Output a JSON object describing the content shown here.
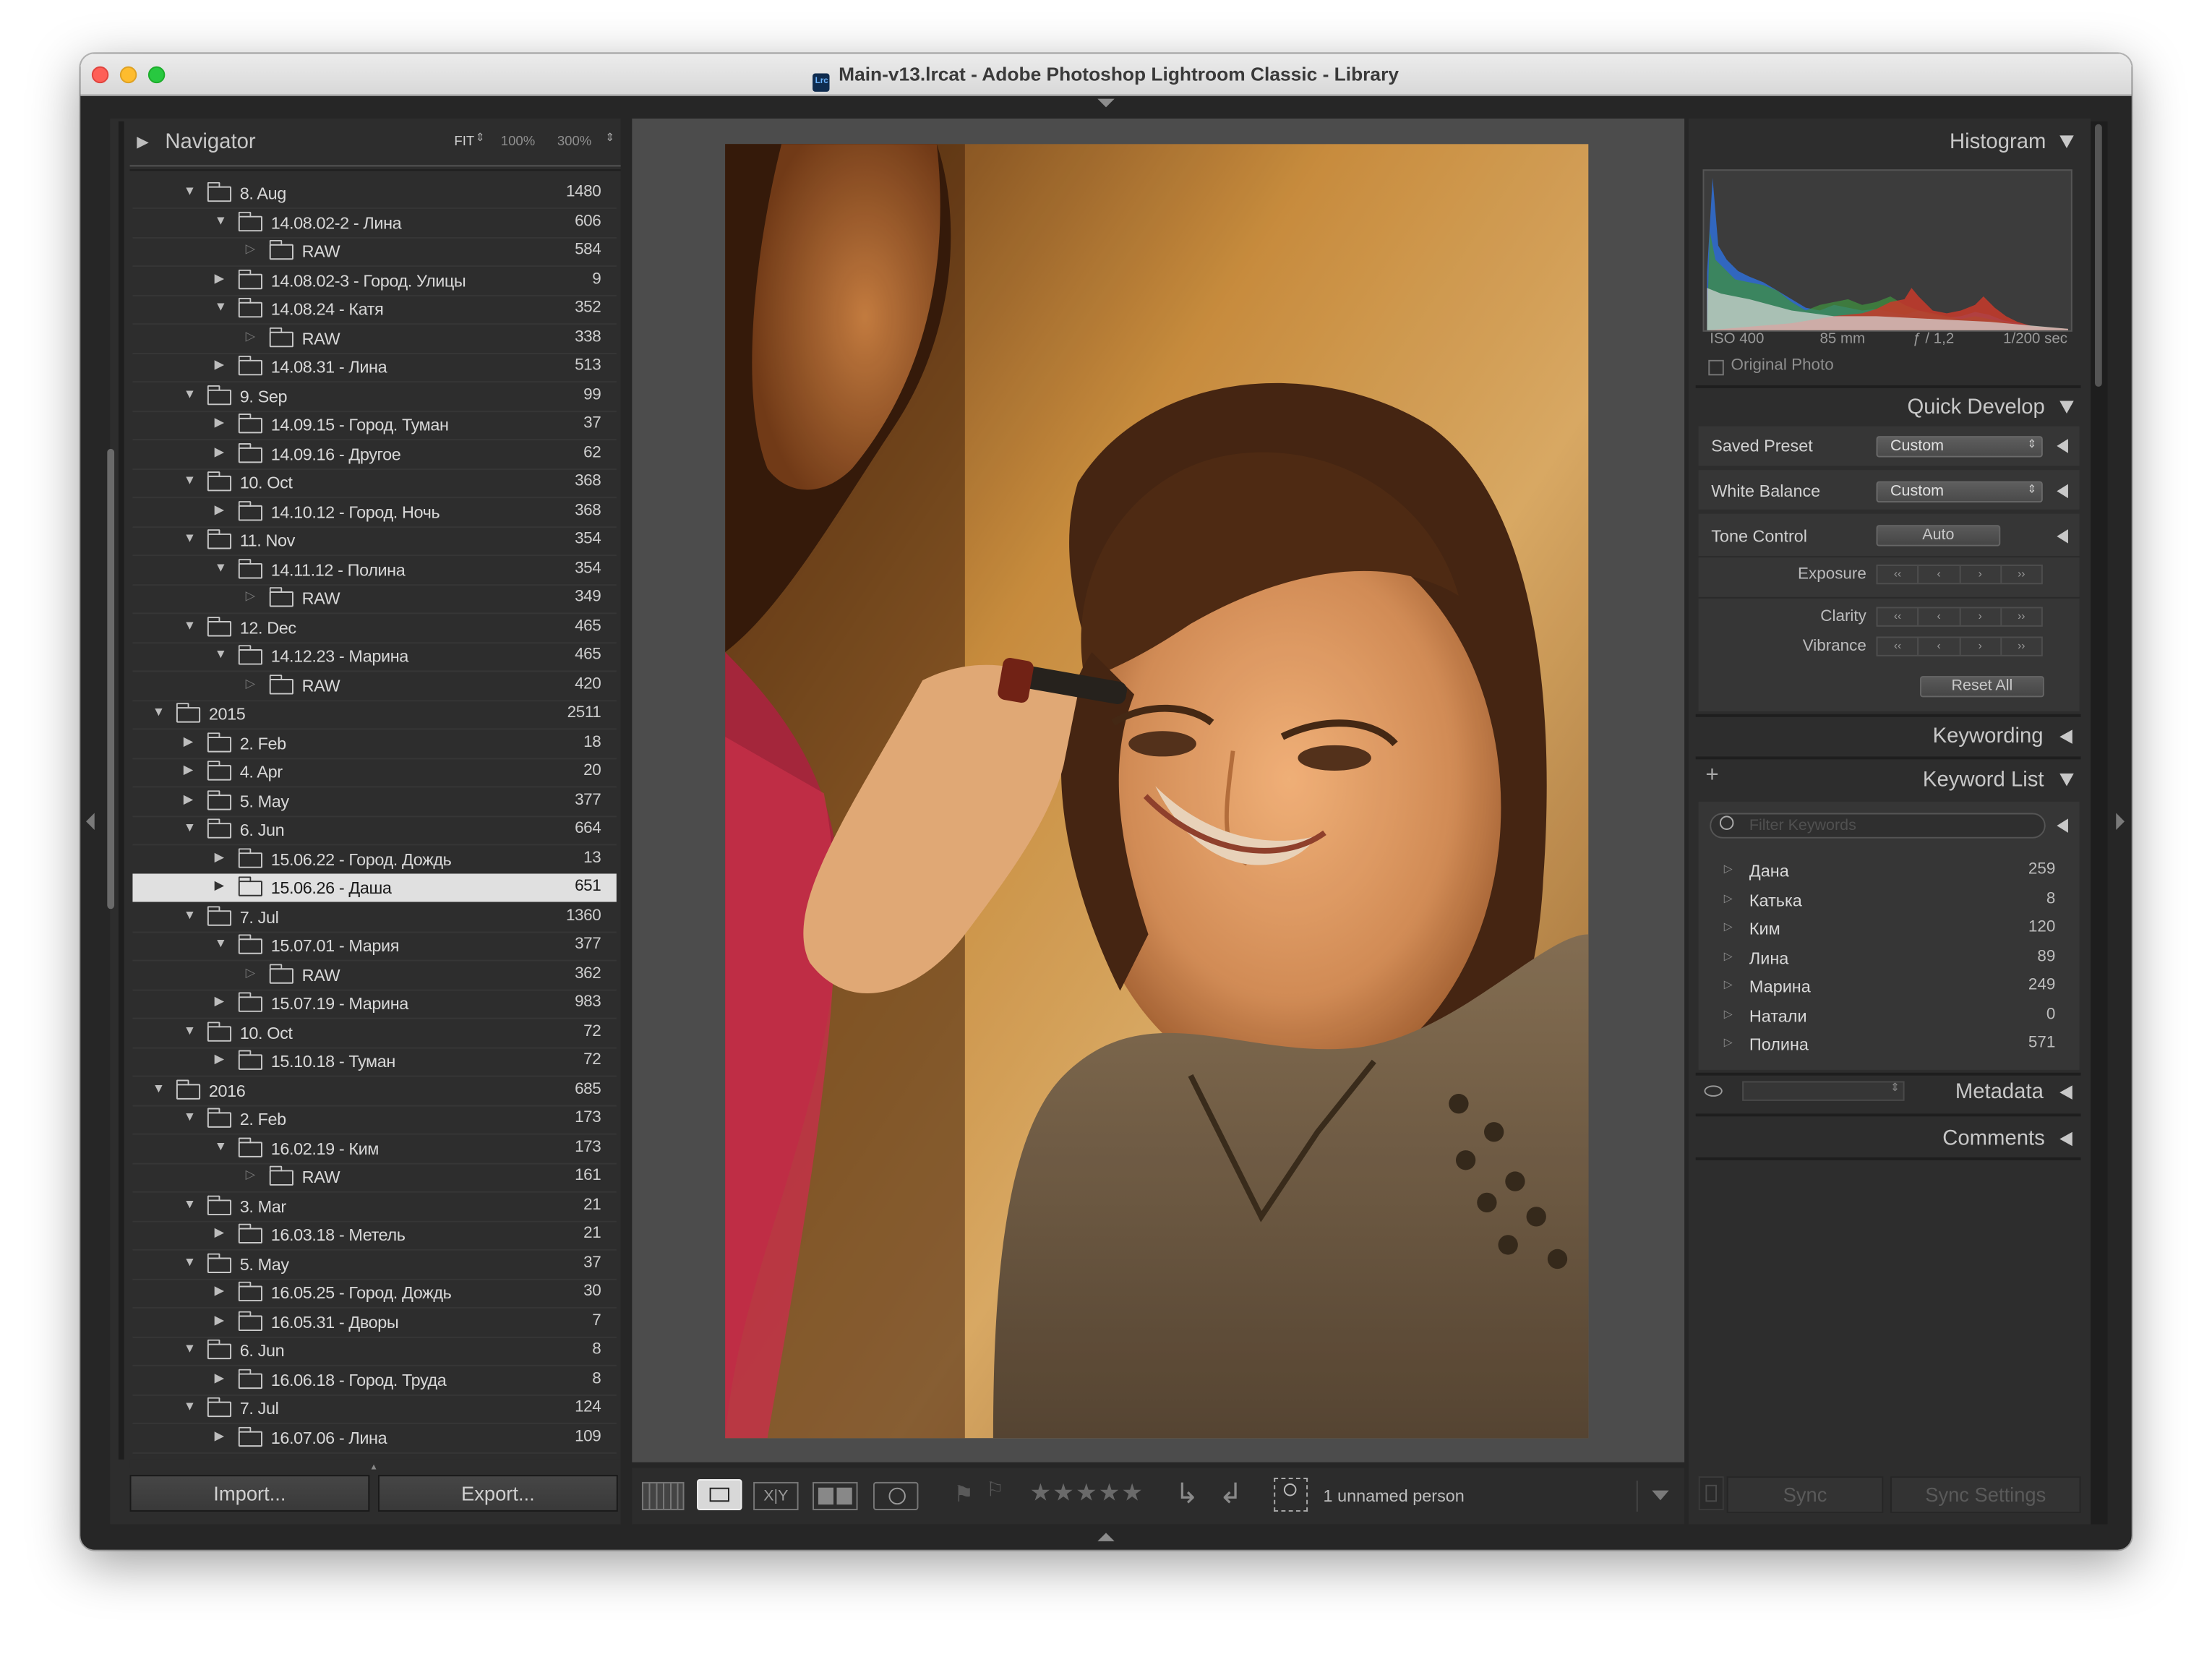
{
  "window": {
    "title": "Main-v13.lrcat - Adobe Photoshop Lightroom Classic - Library",
    "app_icon_text": "Lrc"
  },
  "navigator": {
    "title": "Navigator",
    "zoom_options": [
      "FIT",
      "100%",
      "300%"
    ]
  },
  "folders": [
    {
      "label": "8. Aug",
      "count": "1480",
      "level": 1,
      "expanded": true
    },
    {
      "label": "14.08.02-2 - Лина",
      "count": "606",
      "level": 2,
      "expanded": true
    },
    {
      "label": "RAW",
      "count": "584",
      "level": 3,
      "expanded": false
    },
    {
      "label": "14.08.02-3 - Город. Улицы",
      "count": "9",
      "level": 2,
      "expanded": false
    },
    {
      "label": "14.08.24 - Катя",
      "count": "352",
      "level": 2,
      "expanded": true
    },
    {
      "label": "RAW",
      "count": "338",
      "level": 3,
      "expanded": false
    },
    {
      "label": "14.08.31 - Лина",
      "count": "513",
      "level": 2,
      "expanded": false
    },
    {
      "label": "9. Sep",
      "count": "99",
      "level": 1,
      "expanded": true
    },
    {
      "label": "14.09.15 - Город. Туман",
      "count": "37",
      "level": 2,
      "expanded": false
    },
    {
      "label": "14.09.16 - Другое",
      "count": "62",
      "level": 2,
      "expanded": false
    },
    {
      "label": "10. Oct",
      "count": "368",
      "level": 1,
      "expanded": true
    },
    {
      "label": "14.10.12 - Город. Ночь",
      "count": "368",
      "level": 2,
      "expanded": false
    },
    {
      "label": "11. Nov",
      "count": "354",
      "level": 1,
      "expanded": true
    },
    {
      "label": "14.11.12 - Полина",
      "count": "354",
      "level": 2,
      "expanded": true
    },
    {
      "label": "RAW",
      "count": "349",
      "level": 3,
      "expanded": false
    },
    {
      "label": "12. Dec",
      "count": "465",
      "level": 1,
      "expanded": true
    },
    {
      "label": "14.12.23 - Марина",
      "count": "465",
      "level": 2,
      "expanded": true
    },
    {
      "label": "RAW",
      "count": "420",
      "level": 3,
      "expanded": false
    },
    {
      "label": "2015",
      "count": "2511",
      "level": 0,
      "expanded": true
    },
    {
      "label": "2. Feb",
      "count": "18",
      "level": 1,
      "expanded": false
    },
    {
      "label": "4. Apr",
      "count": "20",
      "level": 1,
      "expanded": false
    },
    {
      "label": "5. May",
      "count": "377",
      "level": 1,
      "expanded": false
    },
    {
      "label": "6. Jun",
      "count": "664",
      "level": 1,
      "expanded": true
    },
    {
      "label": "15.06.22 - Город. Дождь",
      "count": "13",
      "level": 2,
      "expanded": false
    },
    {
      "label": "15.06.26 - Даша",
      "count": "651",
      "level": 2,
      "expanded": false,
      "selected": true
    },
    {
      "label": "7. Jul",
      "count": "1360",
      "level": 1,
      "expanded": true
    },
    {
      "label": "15.07.01 - Мария",
      "count": "377",
      "level": 2,
      "expanded": true
    },
    {
      "label": "RAW",
      "count": "362",
      "level": 3,
      "expanded": false
    },
    {
      "label": "15.07.19 - Марина",
      "count": "983",
      "level": 2,
      "expanded": false
    },
    {
      "label": "10. Oct",
      "count": "72",
      "level": 1,
      "expanded": true
    },
    {
      "label": "15.10.18 - Туман",
      "count": "72",
      "level": 2,
      "expanded": false
    },
    {
      "label": "2016",
      "count": "685",
      "level": 0,
      "expanded": true
    },
    {
      "label": "2. Feb",
      "count": "173",
      "level": 1,
      "expanded": true
    },
    {
      "label": "16.02.19 - Ким",
      "count": "173",
      "level": 2,
      "expanded": true
    },
    {
      "label": "RAW",
      "count": "161",
      "level": 3,
      "expanded": false
    },
    {
      "label": "3. Mar",
      "count": "21",
      "level": 1,
      "expanded": true
    },
    {
      "label": "16.03.18 - Метель",
      "count": "21",
      "level": 2,
      "expanded": false
    },
    {
      "label": "5. May",
      "count": "37",
      "level": 1,
      "expanded": true
    },
    {
      "label": "16.05.25 - Город. Дождь",
      "count": "30",
      "level": 2,
      "expanded": false
    },
    {
      "label": "16.05.31 - Дворы",
      "count": "7",
      "level": 2,
      "expanded": false
    },
    {
      "label": "6. Jun",
      "count": "8",
      "level": 1,
      "expanded": true
    },
    {
      "label": "16.06.18 - Город. Труда",
      "count": "8",
      "level": 2,
      "expanded": false
    },
    {
      "label": "7. Jul",
      "count": "124",
      "level": 1,
      "expanded": true
    },
    {
      "label": "16.07.06 - Лина",
      "count": "109",
      "level": 2,
      "expanded": false
    }
  ],
  "left_buttons": {
    "import": "Import...",
    "export": "Export..."
  },
  "histogram": {
    "title": "Histogram",
    "iso": "ISO 400",
    "focal": "85 mm",
    "aperture": "ƒ / 1,2",
    "shutter": "1/200 sec",
    "original_photo": "Original Photo"
  },
  "quick_develop": {
    "title": "Quick Develop",
    "saved_preset_label": "Saved Preset",
    "saved_preset_value": "Custom",
    "white_balance_label": "White Balance",
    "white_balance_value": "Custom",
    "tone_control_label": "Tone Control",
    "auto_label": "Auto",
    "exposure_label": "Exposure",
    "clarity_label": "Clarity",
    "vibrance_label": "Vibrance",
    "reset_label": "Reset All"
  },
  "keywording": {
    "title": "Keywording"
  },
  "keyword_list": {
    "title": "Keyword List",
    "add": "+",
    "filter_placeholder": "Filter Keywords",
    "items": [
      {
        "name": "Дана",
        "count": "259"
      },
      {
        "name": "Катька",
        "count": "8"
      },
      {
        "name": "Ким",
        "count": "120"
      },
      {
        "name": "Лина",
        "count": "89"
      },
      {
        "name": "Марина",
        "count": "249"
      },
      {
        "name": "Натали",
        "count": "0"
      },
      {
        "name": "Полина",
        "count": "571"
      }
    ]
  },
  "metadata": {
    "title": "Metadata"
  },
  "comments": {
    "title": "Comments"
  },
  "sync": {
    "sync": "Sync",
    "sync_settings": "Sync Settings"
  },
  "toolbar": {
    "stars": "★★★★★",
    "compare_label": "X|Y",
    "people": "1 unnamed person"
  },
  "colors": {
    "window_bg": "#262626",
    "panel_bg": "#2d2d2d",
    "center_bg": "#4c4c4c",
    "selected_row": "#e0e0e0",
    "histogram_blue": "#2f6fd6",
    "histogram_green": "#3f8f3f",
    "histogram_red": "#c83a2a"
  }
}
